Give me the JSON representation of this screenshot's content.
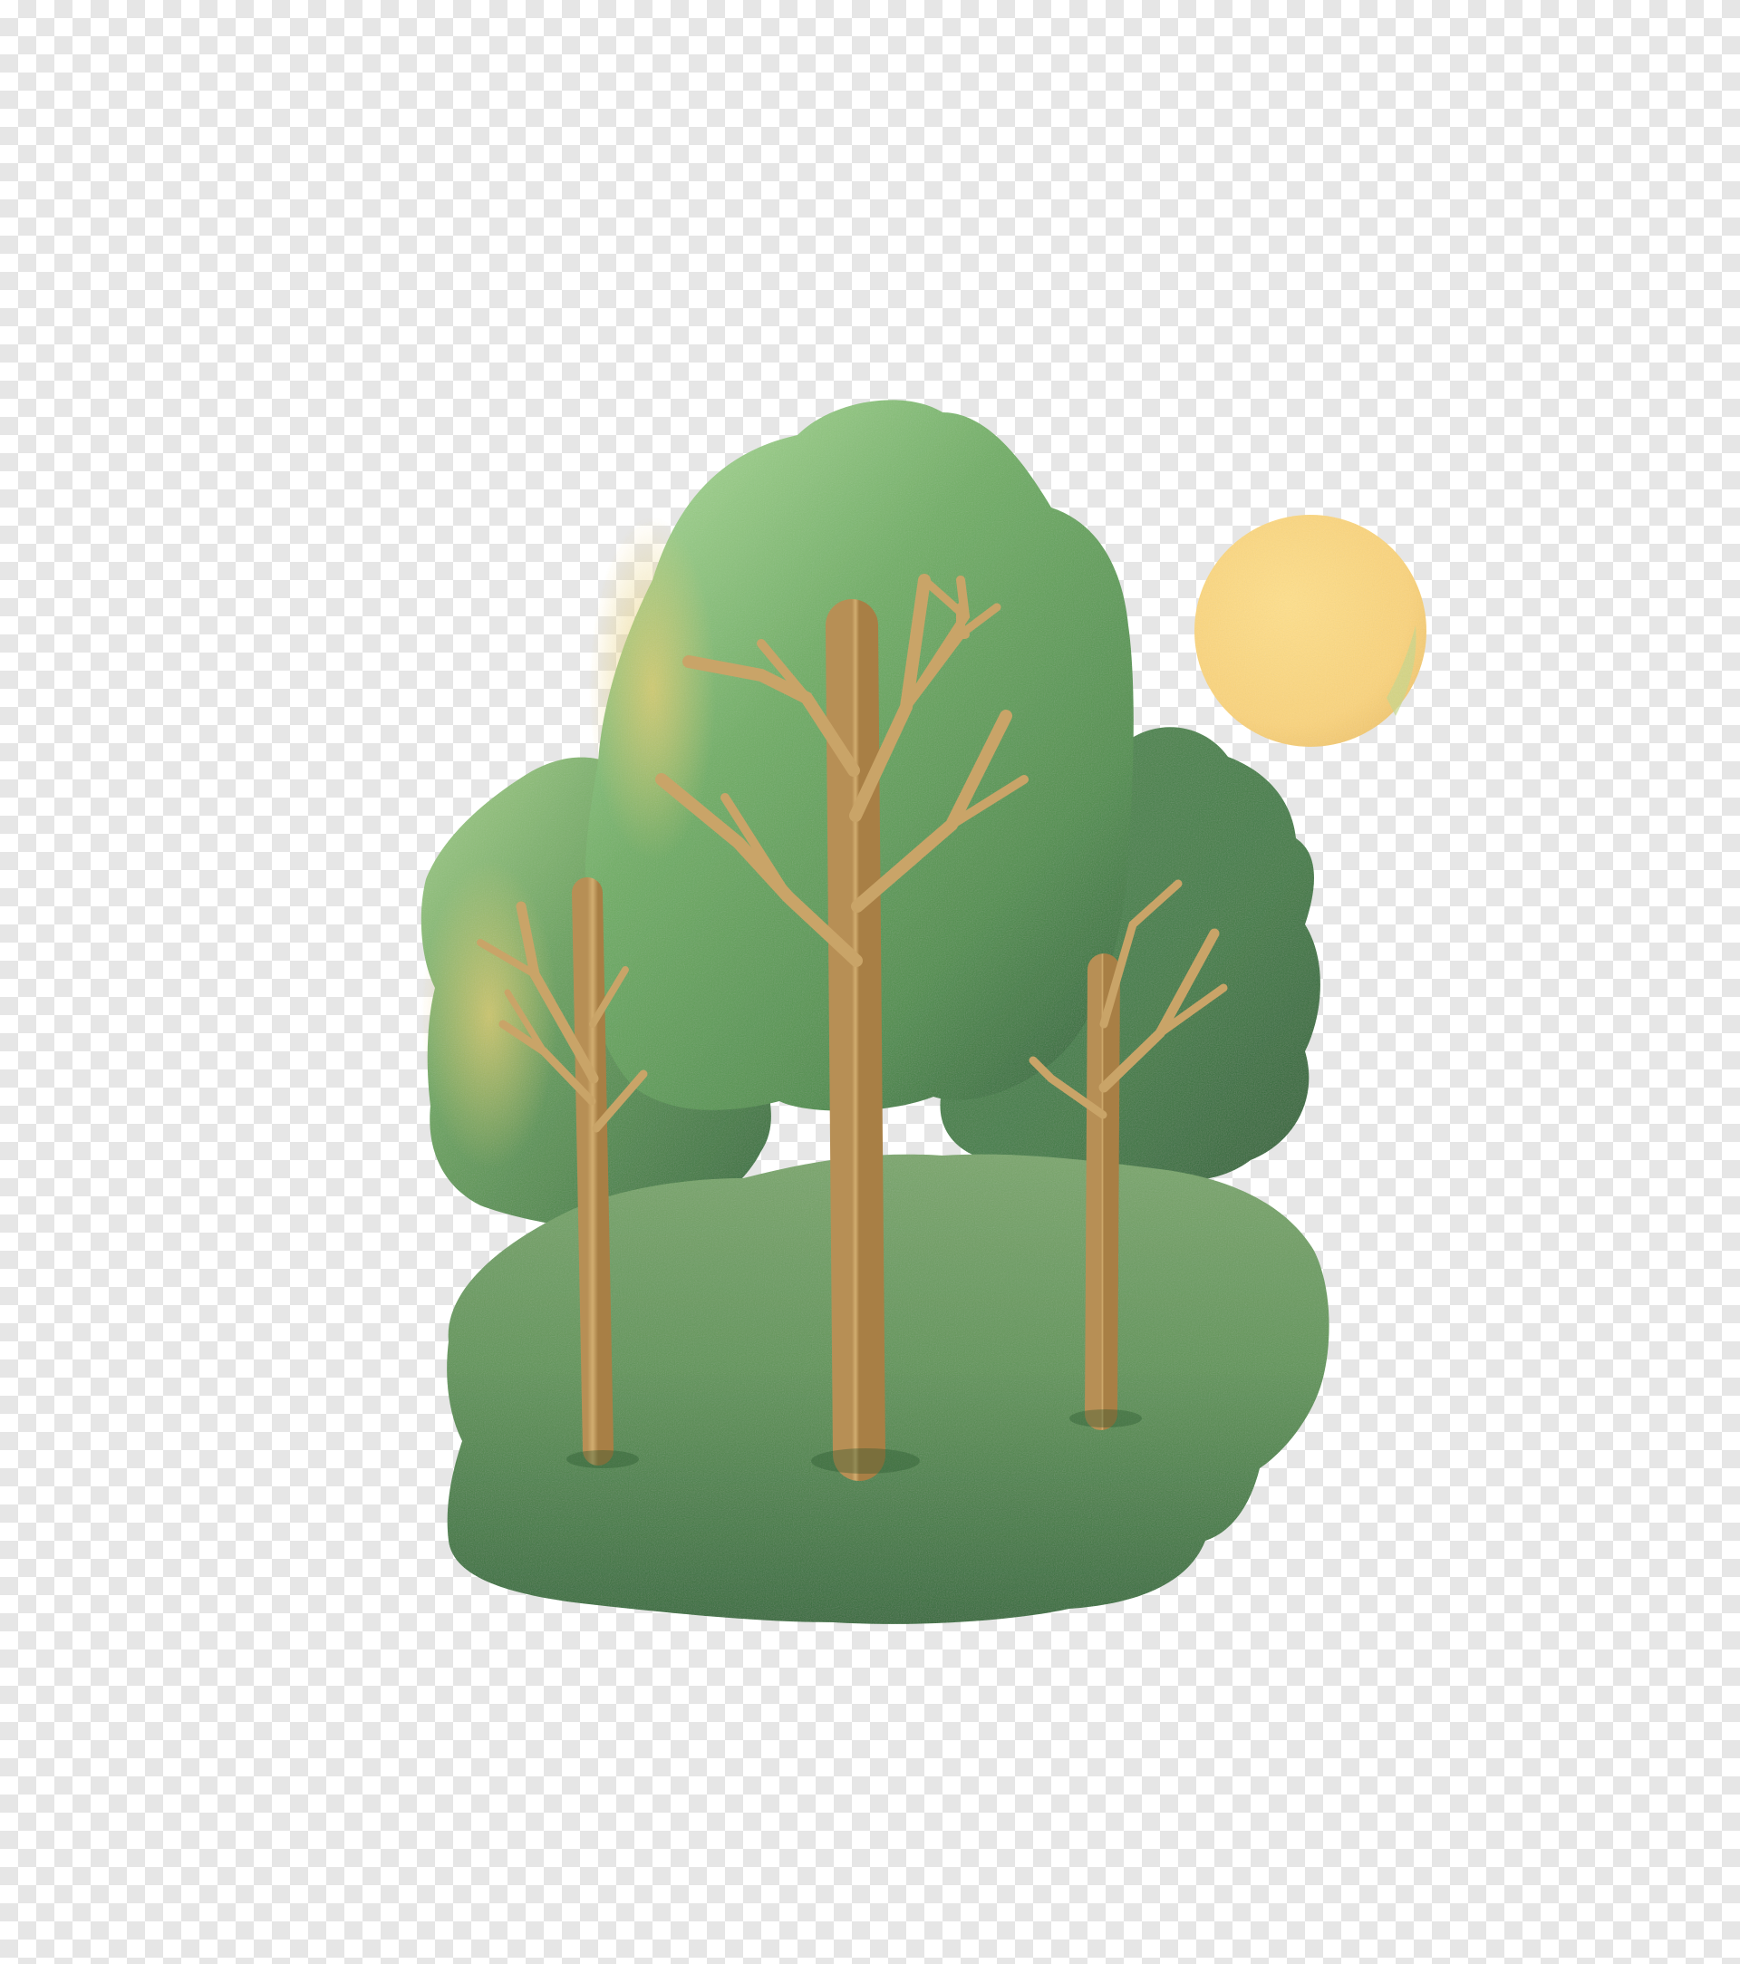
{
  "scene": {
    "subject": "illustration-trees-hill-sun",
    "background": "transparent-checkerboard",
    "colors": {
      "checker_light": "#ffffff",
      "checker_dark": "#e6e6e6",
      "hill_light": "#6e9b60",
      "hill_dark": "#2f6a36",
      "canopy_light": "#9fd08e",
      "canopy_mid": "#5c9a55",
      "canopy_dark": "#2f6a36",
      "canopy_highlight": "#d8c36a",
      "trunk": "#c9a468",
      "trunk_shade": "#a87f45",
      "sun_light": "#ffe08a",
      "sun_edge": "#f5c86b",
      "sun_green_tint": "#c8d98a"
    }
  }
}
